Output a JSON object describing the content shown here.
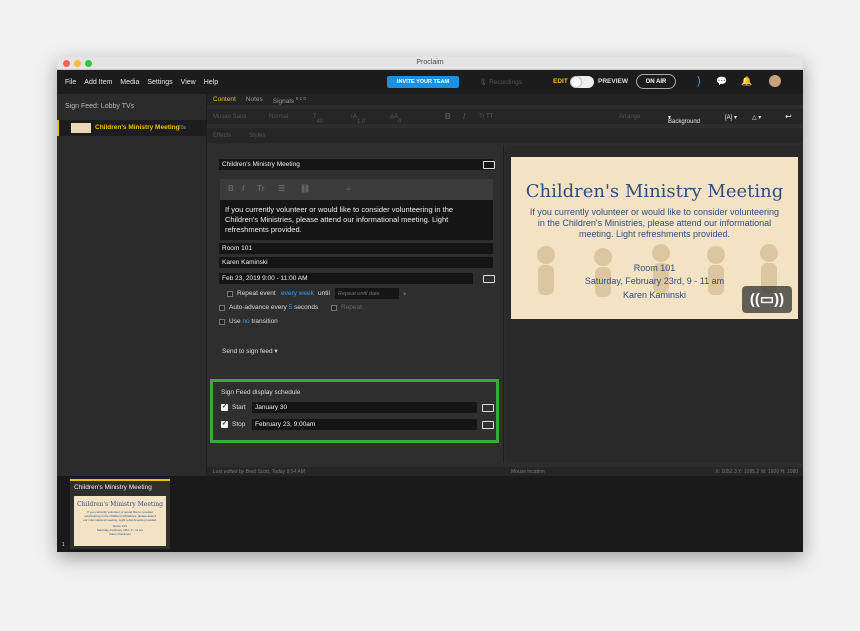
{
  "window": {
    "title": "Proclaim"
  },
  "menu": [
    "File",
    "Add Item",
    "Media",
    "Settings",
    "View",
    "Help"
  ],
  "topbar": {
    "invite": "INVITE YOUR TEAM",
    "recordings": "Recordings",
    "edit": "EDIT",
    "preview": "PREVIEW",
    "on_air": "ON AIR"
  },
  "sidebar": {
    "header": "Sign Feed:  Lobby TVs",
    "item_label": "Children's Ministry Meeting",
    "item_duration": "20s"
  },
  "tabs": [
    "Content",
    "Notes",
    "Signals"
  ],
  "signals_badge": "0 1 0",
  "toolbar": {
    "font": "Museo Sans",
    "weight": "Normal",
    "size": "40",
    "line": "1.0",
    "spacing": "0",
    "arrange": "Arrange",
    "background": "Background",
    "effects": "Effects",
    "styles": "Styles"
  },
  "editor": {
    "title": "Children's Ministry Meeting",
    "description": "If you currently volunteer or would like to consider volunteering in the Children's Ministries, please attend our informational meeting. Light refreshments provided.",
    "location": "Room 101",
    "presenter": "Karen Kaminski",
    "datetime": "Feb 23, 2019 9:00 - 11:00 AM",
    "repeat_label": "Repeat event",
    "repeat_freq": "every week",
    "until": "until",
    "until_placeholder": "Repeat until date",
    "auto_advance_pre": "Auto-advance every",
    "auto_advance_num": "5",
    "auto_advance_post": "seconds",
    "repeat": "Repeat",
    "use": "Use",
    "transition_val": "no",
    "transition": "transition",
    "send": "Send to sign feed"
  },
  "schedule": {
    "title": "Sign Feed display schedule",
    "start_label": "Start",
    "start_value": "January 30",
    "stop_label": "Stop",
    "stop_value": "February 23, 9:00am"
  },
  "preview": {
    "title": "Children's Ministry Meeting",
    "desc": "If you currently volunteer or would like to consider volunteering in the Children's Ministries, please attend our informational meeting. Light refreshments provided.",
    "room": "Room 101",
    "date": "Saturday, February 23rd, 9 - 11 am",
    "presenter": "Karen Kaminski"
  },
  "status": {
    "edited": "Last edited by Brett Scott, Today 9:54 AM",
    "mouse": "Mouse location",
    "coords": "X: 1052.3  Y: 1085.2   W: 1920  H: 1080"
  },
  "strip": {
    "card_label": "Children's Ministry Meeting",
    "index": "1"
  }
}
